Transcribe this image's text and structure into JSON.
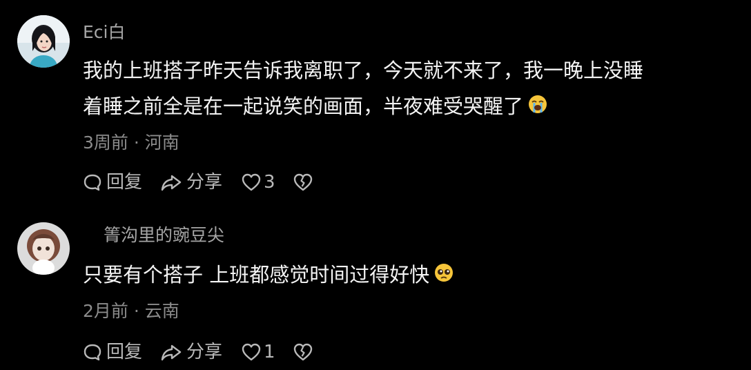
{
  "comments": [
    {
      "username": "Eci白",
      "text_lines": [
        "我的上班搭子昨天告诉我离职了，今天就不来了，我一晚上没睡",
        "着睡之前全是在一起说笑的画面，半夜难受哭醒了"
      ],
      "emoji": "loudly-crying-face",
      "meta": "3周前 · 河南",
      "reply_label": "回复",
      "share_label": "分享",
      "like_count": "3"
    },
    {
      "username": "箐沟里的豌豆尖",
      "text_lines": [
        "只要有个搭子 上班都感觉时间过得好快"
      ],
      "emoji": "pleading-face",
      "meta": "2月前 · 云南",
      "reply_label": "回复",
      "share_label": "分享",
      "like_count": "1"
    }
  ],
  "colors": {
    "background": "#000000",
    "text": "#f4f4f4",
    "username": "#a6a6a6",
    "meta": "#8c8c8c",
    "actions": "#b9b9b9"
  },
  "icons": [
    "speech-bubble-icon",
    "share-arrow-icon",
    "heart-icon",
    "broken-heart-icon"
  ]
}
